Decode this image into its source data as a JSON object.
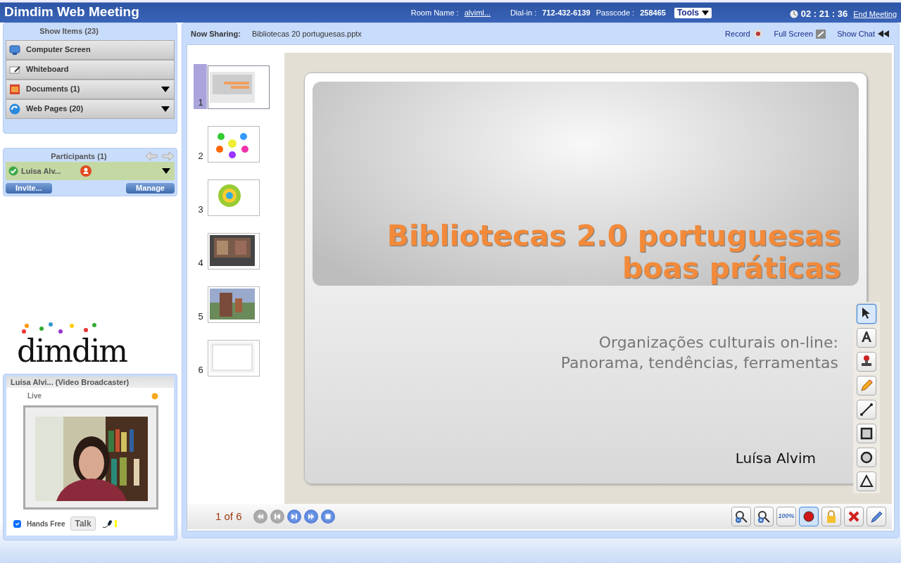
{
  "header": {
    "title": "Dimdim Web Meeting",
    "room_label": "Room Name :",
    "room_value": "alviml...",
    "dialin_label": "Dial-in :",
    "dialin_value": "712-432-6139",
    "passcode_label": "Passcode :",
    "passcode_value": "258465",
    "tools": "Tools",
    "timer": "02 : 21 : 36",
    "end_meeting": "End Meeting"
  },
  "show_items": {
    "title": "Show Items (23)",
    "items": [
      {
        "kind": "screen",
        "label": "Computer Screen",
        "has_menu": false
      },
      {
        "kind": "whiteboard",
        "label": "Whiteboard",
        "has_menu": false
      },
      {
        "kind": "documents",
        "label": "Documents (1)",
        "has_menu": true
      },
      {
        "kind": "web",
        "label": "Web Pages (20)",
        "has_menu": true
      }
    ]
  },
  "participants": {
    "title": "Participants (1)",
    "people": [
      {
        "name": "Luisa Alv...",
        "online": true,
        "presenter": true
      }
    ],
    "invite": "Invite...",
    "manage": "Manage"
  },
  "logo": "dimdim",
  "video": {
    "title": "Luisa Alvi... (Video Broadcaster)",
    "status": "Live",
    "hands_free": {
      "label": "Hands Free",
      "checked": true
    },
    "talk": "Talk"
  },
  "sharing": {
    "label": "Now Sharing:",
    "file": "Bibliotecas 20 portuguesas.pptx",
    "record": "Record",
    "full_screen": "Full Screen",
    "show_chat": "Show Chat"
  },
  "thumbnails": [
    {
      "number": "1",
      "selected": true
    },
    {
      "number": "2",
      "selected": false
    },
    {
      "number": "3",
      "selected": false
    },
    {
      "number": "4",
      "selected": false
    },
    {
      "number": "5",
      "selected": false
    },
    {
      "number": "6",
      "selected": false
    }
  ],
  "slide": {
    "title_lines": [
      "Bibliotecas 2.0 portuguesas",
      "boas práticas"
    ],
    "subtitle_lines": [
      "Organizações culturais on-line:",
      "Panorama, tendências, ferramentas"
    ],
    "author": "Luísa Alvim"
  },
  "draw_tools": [
    {
      "kind": "select",
      "selected": true
    },
    {
      "kind": "text",
      "selected": false
    },
    {
      "kind": "stamp",
      "selected": false
    },
    {
      "kind": "pencil",
      "selected": false
    },
    {
      "kind": "line",
      "selected": false
    },
    {
      "kind": "rectangle",
      "selected": false
    },
    {
      "kind": "circle",
      "selected": false
    },
    {
      "kind": "triangle",
      "selected": false
    }
  ],
  "pager": {
    "text": "1 of 6",
    "nav": [
      {
        "kind": "first",
        "disabled": true
      },
      {
        "kind": "previous",
        "disabled": true
      },
      {
        "kind": "next",
        "disabled": false
      },
      {
        "kind": "last",
        "disabled": false
      },
      {
        "kind": "stop",
        "disabled": false
      }
    ]
  },
  "bottom_tools": [
    {
      "kind": "zoom-out",
      "selected": false
    },
    {
      "kind": "zoom-in",
      "selected": false
    },
    {
      "kind": "fit",
      "label": "100%",
      "selected": false
    },
    {
      "kind": "record",
      "selected": true
    },
    {
      "kind": "lock",
      "selected": false
    },
    {
      "kind": "clear",
      "selected": false
    },
    {
      "kind": "annotate",
      "selected": false
    }
  ]
}
